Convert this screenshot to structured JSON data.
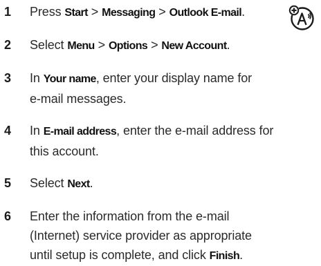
{
  "icon": "personalize-feature-icon",
  "steps": [
    {
      "num": "1",
      "parts": [
        "Press ",
        "Start",
        " > ",
        "Messaging",
        " > ",
        "Outlook E-mail",
        "."
      ]
    },
    {
      "num": "2",
      "parts": [
        "Select ",
        "Menu",
        " > ",
        "Options",
        " > ",
        "New Account",
        "."
      ]
    },
    {
      "num": "3",
      "line1": [
        "In ",
        "Your name",
        ", enter your display name for"
      ],
      "line2": "e-mail messages."
    },
    {
      "num": "4",
      "line1": [
        "In ",
        "E-mail address",
        ", enter the e-mail address for"
      ],
      "line2": "this account."
    },
    {
      "num": "5",
      "parts": [
        "Select ",
        "Next",
        "."
      ]
    },
    {
      "num": "6",
      "line1": "Enter the information from the e-mail",
      "line2": "(Internet) service provider as appropriate",
      "line3": [
        "until setup is complete, and click ",
        "Finish",
        "."
      ]
    }
  ]
}
